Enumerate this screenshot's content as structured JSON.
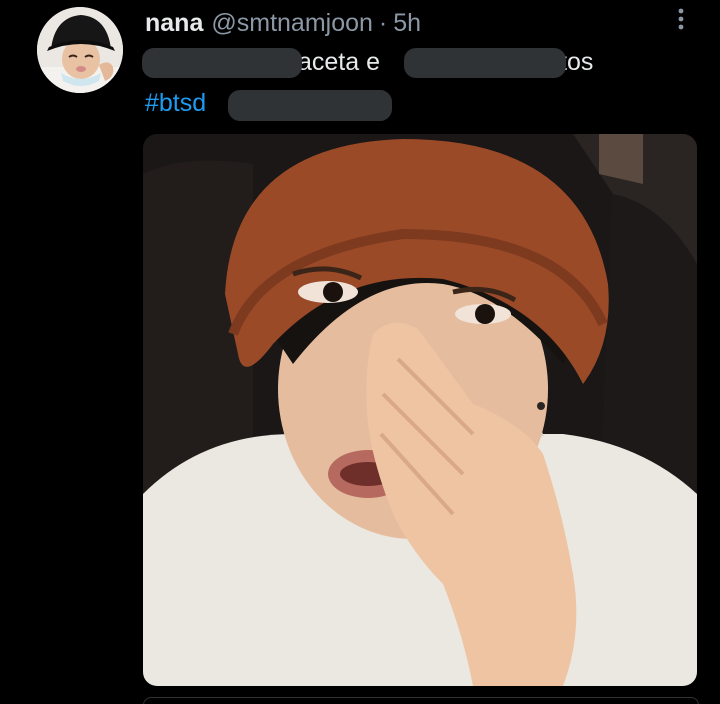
{
  "tweet": {
    "author_name": "nana",
    "author_handle": "@smtnamjoon",
    "separator": "·",
    "timestamp": "5h",
    "text_fragment_1": "aceta e",
    "text_fragment_2": "tos",
    "hashtag_fragment": "#btsd"
  },
  "icons": {
    "more": "more-options-icon"
  },
  "colors": {
    "background": "#000000",
    "primary_text": "#e7e9ea",
    "secondary_text": "#8b98a5",
    "hashtag": "#1d9bf0",
    "redaction": "#2f3336"
  }
}
